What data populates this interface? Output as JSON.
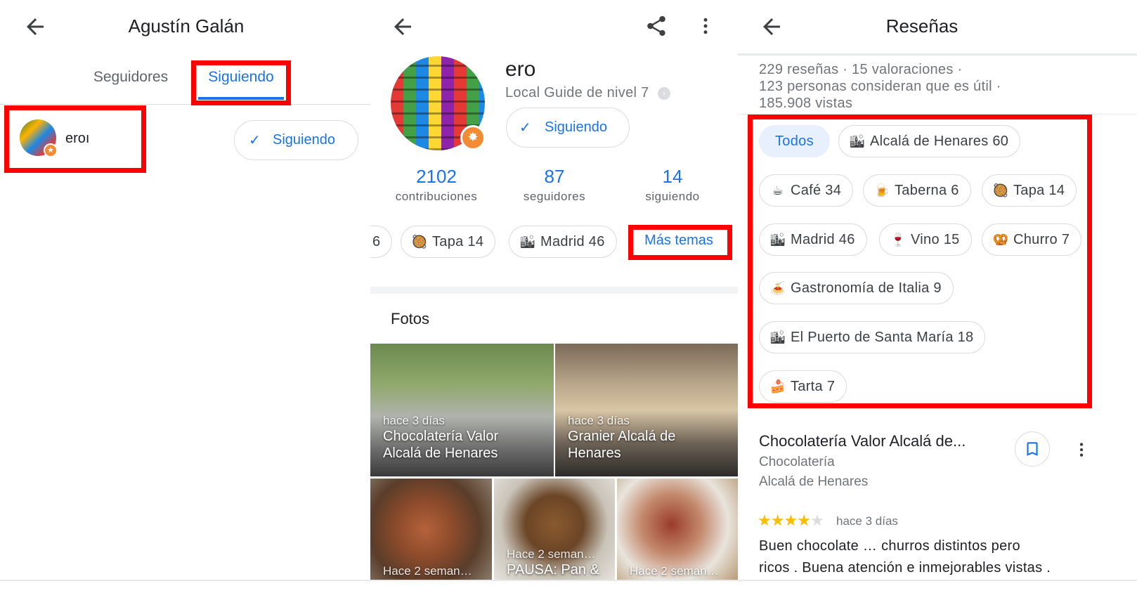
{
  "panel1": {
    "title": "Agustín Galán",
    "tabs": [
      "Seguidores",
      "Siguiendo"
    ],
    "user": {
      "name": "eroı",
      "button": "Siguiendo"
    }
  },
  "panel2": {
    "profile": {
      "name": "ero",
      "level": "Local Guide de nivel 7",
      "follow_button": "Siguiendo"
    },
    "stats": [
      {
        "num": "2102",
        "label": "contribuciones"
      },
      {
        "num": "87",
        "label": "seguidores"
      },
      {
        "num": "14",
        "label": "siguiendo"
      }
    ],
    "topics": [
      {
        "icon": "",
        "label": "6"
      },
      {
        "icon": "🥘",
        "label": "Tapa 14"
      },
      {
        "icon": "🏙",
        "label": "Madrid 46"
      }
    ],
    "more_topics": "Más temas",
    "photos_heading": "Fotos",
    "photos": [
      {
        "when": "hace 3 días",
        "place": "Chocolatería Valor Alcalá de Henares"
      },
      {
        "when": "hace 3 días",
        "place": "Granier Alcalá de Henares"
      },
      {
        "when": "Hace 2 seman…",
        "place": ""
      },
      {
        "when": "Hace 2 seman…",
        "place": "PAUSA: Pan &"
      },
      {
        "when": "Hace 2 seman…",
        "place": ""
      }
    ]
  },
  "panel3": {
    "title": "Reseñas",
    "summary_line1": "229 reseñas · 15 valoraciones ·",
    "summary_line2": "123 personas consideran que es útil ·",
    "summary_line3": "185.908 vistas",
    "filters": [
      {
        "icon": "",
        "label": "Todos"
      },
      {
        "icon": "🏙",
        "label": "Alcalá de Henares 60"
      },
      {
        "icon": "☕",
        "label": "Café 34"
      },
      {
        "icon": "🍺",
        "label": "Taberna 6"
      },
      {
        "icon": "🥘",
        "label": "Tapa 14"
      },
      {
        "icon": "🏙",
        "label": "Madrid 46"
      },
      {
        "icon": "🍷",
        "label": "Vino 15"
      },
      {
        "icon": "🥨",
        "label": "Churro 7"
      },
      {
        "icon": "🍝",
        "label": "Gastronomía de Italia 9"
      },
      {
        "icon": "🏙",
        "label": "El Puerto de Santa María 18"
      },
      {
        "icon": "🍰",
        "label": "Tarta 7"
      }
    ],
    "review": {
      "place": "Chocolatería Valor Alcalá de...",
      "category": "Chocolatería",
      "city": "Alcalá de Henares",
      "rating": 4,
      "when": "hace 3 días",
      "text_line1": "Buen chocolate … churros distintos pero",
      "text_line2": "ricos . Buena atención e inmejorables vistas ."
    }
  },
  "colors": {
    "accent": "#1a73e8",
    "highlight": "#ff0000",
    "star": "#fbbc04",
    "chip_selected": "#e8f0fe"
  }
}
